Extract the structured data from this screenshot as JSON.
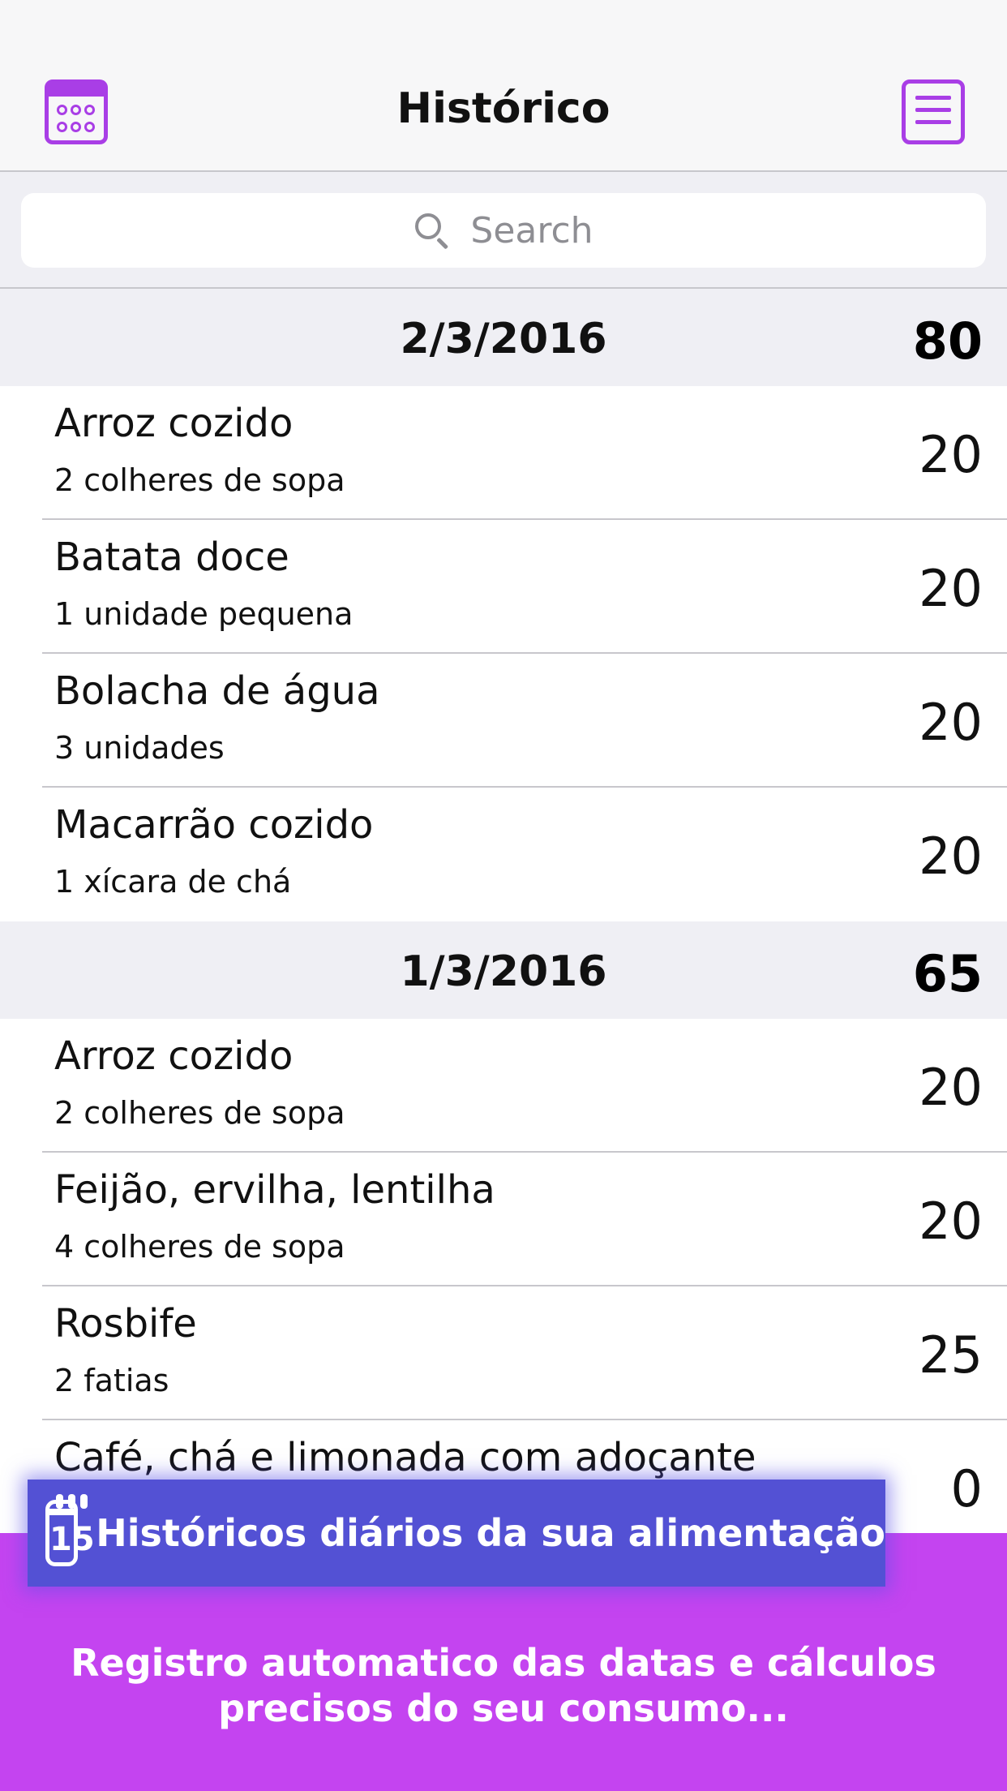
{
  "navbar": {
    "title": "Histórico",
    "left_icon": "calendar-icon",
    "right_icon": "menu-list-icon"
  },
  "search": {
    "placeholder": "Search",
    "icon": "search-icon"
  },
  "sections": [
    {
      "date": "2/3/2016",
      "total": "80",
      "items": [
        {
          "name": "Arroz cozido",
          "portion": "2 colheres de sopa",
          "value": "20"
        },
        {
          "name": "Batata doce",
          "portion": "1 unidade pequena",
          "value": "20"
        },
        {
          "name": "Bolacha de água",
          "portion": "3 unidades",
          "value": "20"
        },
        {
          "name": "Macarrão cozido",
          "portion": "1 xícara de chá",
          "value": "20"
        }
      ]
    },
    {
      "date": "1/3/2016",
      "total": "65",
      "items": [
        {
          "name": "Arroz cozido",
          "portion": "2 colheres de sopa",
          "value": "20"
        },
        {
          "name": "Feijão, ervilha, lentilha",
          "portion": "4 colheres de sopa",
          "value": "20"
        },
        {
          "name": "Rosbife",
          "portion": "2 fatias",
          "value": "25"
        },
        {
          "name": "Café, chá e limonada com adoçante",
          "portion": "",
          "value": "0"
        }
      ]
    }
  ],
  "promo": {
    "icon": "calendar-15-icon",
    "icon_number": "15",
    "banner_text": "Históricos diários da sua alimentação",
    "caption": "Registro automatico das datas e cálculos precisos do seu consumo...",
    "colors": {
      "banner": "#5351d4",
      "background": "#c444f0",
      "accent": "#a93ee6"
    }
  }
}
